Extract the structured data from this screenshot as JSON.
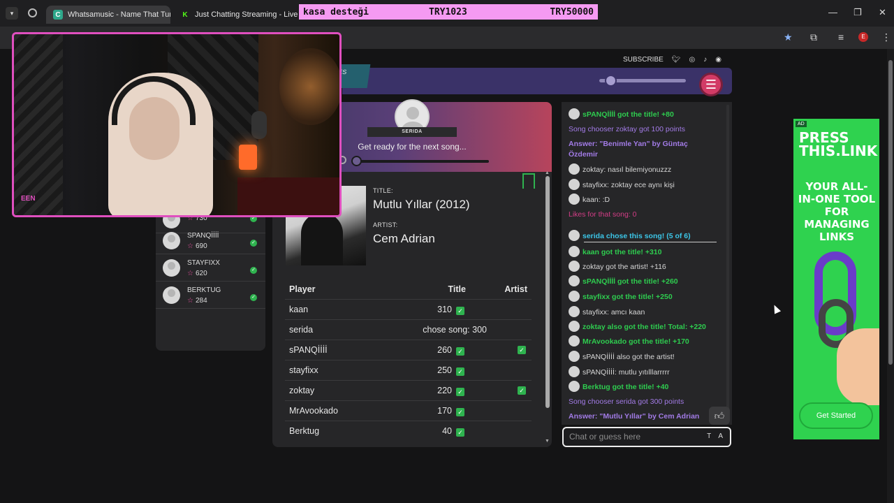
{
  "browser": {
    "tabs": [
      {
        "title": "Whatsamusic - Name That Tune",
        "favicon": "whatsamusic-favicon",
        "active": true
      },
      {
        "title": "Just Chatting Streaming - Live S",
        "favicon": "kick-favicon",
        "active": false
      }
    ],
    "profile_initial": "E"
  },
  "donation": {
    "label": "kasa desteği",
    "current": "TRY1023",
    "goal": "TRY50000",
    "color": "#f59af2"
  },
  "header": {
    "games_label": "MES",
    "subscribe": "SUBSCRIBE",
    "social_icons": [
      "twitter-icon",
      "instagram-icon",
      "tiktok-icon",
      "discord-icon"
    ],
    "menu_icon": "hamburger-icon",
    "accent": "#3a3268"
  },
  "leaderboard": [
    {
      "name": "",
      "score": "730"
    },
    {
      "name": "SPANQİİİİ",
      "score": "690"
    },
    {
      "name": "STAYFIXX",
      "score": "620"
    },
    {
      "name": "BERKTUG",
      "score": "284"
    }
  ],
  "game": {
    "chooser": "SERIDA",
    "status": "Get ready for the next song...",
    "title_label": "TITLE:",
    "title": "Mutlu Yıllar (2012)",
    "artist_label": "ARTIST:",
    "artist": "Cem Adrian",
    "table": {
      "headers": [
        "Player",
        "Title",
        "Artist"
      ],
      "rows": [
        {
          "player": "kaan",
          "title": "310",
          "title_check": true,
          "artist_check": false
        },
        {
          "player": "serida",
          "title": "chose song: 300",
          "title_check": false,
          "artist_check": false
        },
        {
          "player": "sPANQİİİİ",
          "title": "260",
          "title_check": true,
          "artist_check": true
        },
        {
          "player": "stayfixx",
          "title": "250",
          "title_check": true,
          "artist_check": false
        },
        {
          "player": "zoktay",
          "title": "220",
          "title_check": true,
          "artist_check": true
        },
        {
          "player": "MrAvookado",
          "title": "170",
          "title_check": true,
          "artist_check": false
        },
        {
          "player": "Berktug",
          "title": "40",
          "title_check": true,
          "artist_check": false
        }
      ]
    }
  },
  "chat": {
    "messages": [
      {
        "avatar": true,
        "style": "green",
        "text": "sPANQİİİİ got the title! +80"
      },
      {
        "avatar": false,
        "style": "purple",
        "text": "Song chooser zoktay got 100 points"
      },
      {
        "avatar": false,
        "style": "purpleb",
        "text": "Answer: \"Benimle Yan\" by Güntaç"
      },
      {
        "avatar": false,
        "style": "purpleb",
        "text": "Özdemir"
      },
      {
        "avatar": true,
        "style": "gray",
        "text": "zoktay: nasıl bilemiyonuzzz"
      },
      {
        "avatar": true,
        "style": "gray",
        "text": "stayfixx: zoktay ece aynı kişi"
      },
      {
        "avatar": true,
        "style": "gray",
        "text": "kaan: :D"
      },
      {
        "avatar": false,
        "style": "pink",
        "text": "Likes for that song: 0"
      },
      {
        "avatar": true,
        "style": "cyan",
        "text": "serida chose this song! (5 of 6)"
      },
      {
        "avatar": true,
        "style": "green",
        "text": "kaan got the title! +310"
      },
      {
        "avatar": true,
        "style": "gray",
        "text": "zoktay got the artist! +116"
      },
      {
        "avatar": true,
        "style": "green",
        "text": "sPANQİİİİ got the title! +260"
      },
      {
        "avatar": true,
        "style": "green",
        "text": "stayfixx got the title! +250"
      },
      {
        "avatar": true,
        "style": "gray",
        "text": "stayfixx: amcı kaan"
      },
      {
        "avatar": true,
        "style": "green",
        "text": "zoktay also got the title! Total: +220"
      },
      {
        "avatar": true,
        "style": "green",
        "text": "MrAvookado got the title! +170"
      },
      {
        "avatar": true,
        "style": "gray",
        "text": "sPANQİİİİ also got the artist!"
      },
      {
        "avatar": true,
        "style": "gray",
        "text": "sPANQİİİİ: mutlu yıtılllarrrrr"
      },
      {
        "avatar": true,
        "style": "green",
        "text": "Berktug got the title! +40"
      },
      {
        "avatar": false,
        "style": "purple",
        "text": "Song chooser serida got 300 points"
      },
      {
        "avatar": false,
        "style": "purpleb",
        "text": "Answer: \"Mutlu Yıllar\" by Cem Adrian"
      }
    ],
    "input_placeholder": "Chat or guess here",
    "input_tools": "T A",
    "like_icon": "thumbs-up-icon"
  },
  "ad": {
    "tag": "AD",
    "headline": "PRESS THIS.LINK",
    "subhead": "YOUR ALL-IN-ONE TOOL FOR MANAGING LINKS",
    "cta": "Get Started",
    "color": "#2fd24f"
  },
  "webcam": {
    "watermark": "EEN"
  }
}
